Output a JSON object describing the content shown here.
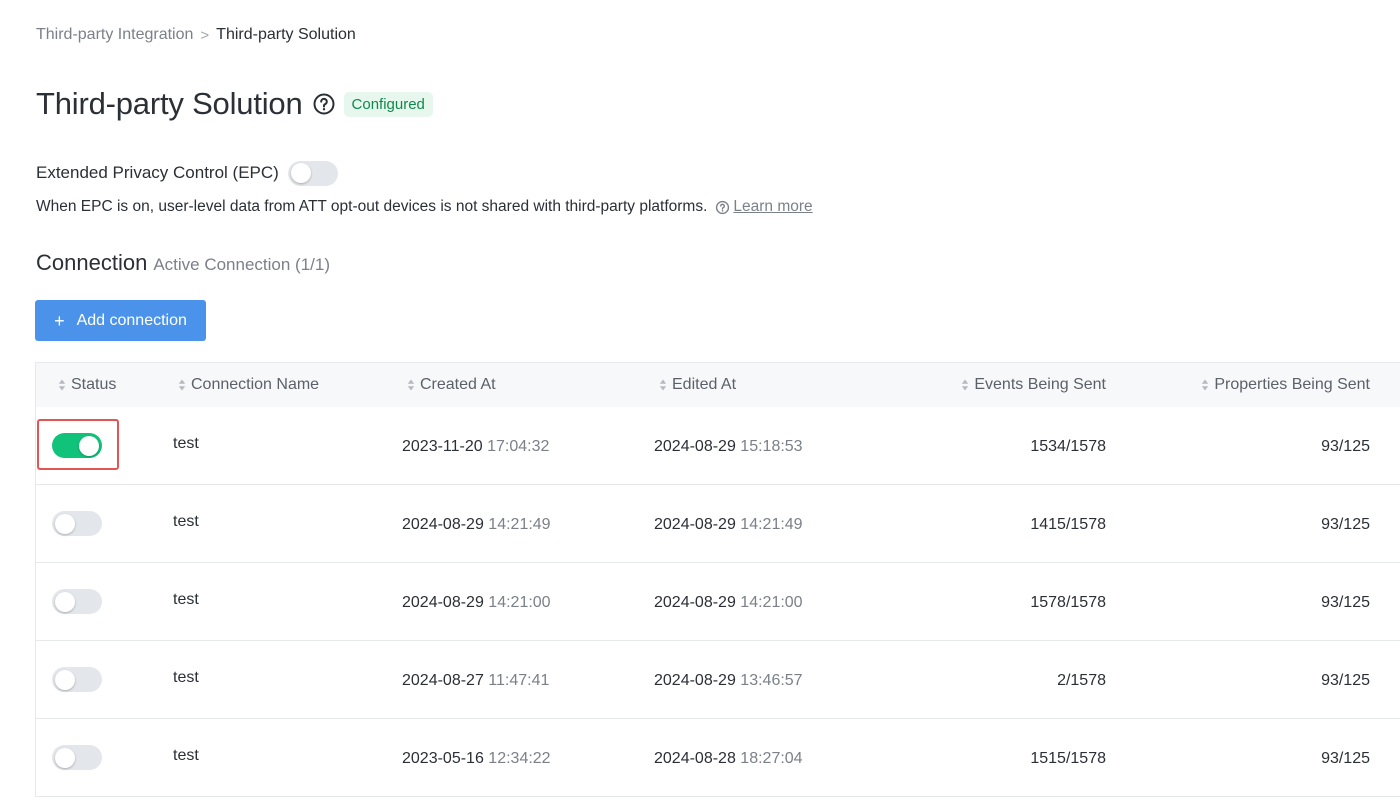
{
  "breadcrumb": {
    "parent": "Third-party Integration",
    "separator": ">",
    "current": "Third-party Solution"
  },
  "page": {
    "title": "Third-party Solution",
    "badge": "Configured"
  },
  "epc": {
    "label": "Extended Privacy Control (EPC)",
    "enabled": false,
    "description": "When EPC is on, user-level data from ATT opt-out devices is not shared with third-party platforms.",
    "learn_more": "Learn more"
  },
  "connection": {
    "title": "Connection",
    "subtitle": "Active Connection (1/1)",
    "add_button": "Add connection"
  },
  "table": {
    "columns": [
      "Status",
      "Connection Name",
      "Created At",
      "Edited At",
      "Events Being Sent",
      "Properties Being Sent"
    ],
    "rows": [
      {
        "enabled": true,
        "name": "test",
        "created_date": "2023-11-20",
        "created_time": "17:04:32",
        "edited_date": "2024-08-29",
        "edited_time": "15:18:53",
        "events": "1534/1578",
        "properties": "93/125"
      },
      {
        "enabled": false,
        "name": "test",
        "created_date": "2024-08-29",
        "created_time": "14:21:49",
        "edited_date": "2024-08-29",
        "edited_time": "14:21:49",
        "events": "1415/1578",
        "properties": "93/125"
      },
      {
        "enabled": false,
        "name": "test",
        "created_date": "2024-08-29",
        "created_time": "14:21:00",
        "edited_date": "2024-08-29",
        "edited_time": "14:21:00",
        "events": "1578/1578",
        "properties": "93/125"
      },
      {
        "enabled": false,
        "name": "test",
        "created_date": "2024-08-27",
        "created_time": "11:47:41",
        "edited_date": "2024-08-29",
        "edited_time": "13:46:57",
        "events": "2/1578",
        "properties": "93/125"
      },
      {
        "enabled": false,
        "name": "test",
        "created_date": "2023-05-16",
        "created_time": "12:34:22",
        "edited_date": "2024-08-28",
        "edited_time": "18:27:04",
        "events": "1515/1578",
        "properties": "93/125"
      }
    ]
  },
  "colors": {
    "accent": "#4b93ea",
    "toggle_on": "#11c27a",
    "badge_text": "#0f8a4c",
    "badge_bg": "#e7f7ee",
    "highlight": "#e15555"
  },
  "icons": {
    "help": "question-circle-icon",
    "info": "question-circle-icon",
    "sort": "sort-icon",
    "add": "plus-icon"
  }
}
